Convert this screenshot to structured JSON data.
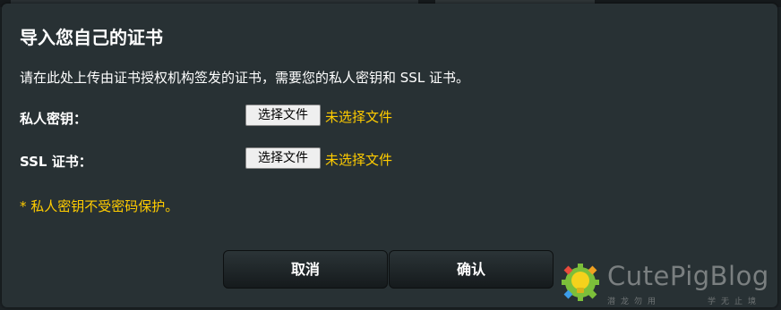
{
  "dialog": {
    "title": "导入您自己的证书",
    "description": "请在此处上传由证书授权机构签发的证书，需要您的私人密钥和 SSL 证书。",
    "fields": [
      {
        "label": "私人密钥：",
        "button_label": "选择文件",
        "status": "未选择文件"
      },
      {
        "label": "SSL 证书：",
        "button_label": "选择文件",
        "status": "未选择文件"
      }
    ],
    "note": "* 私人密钥不受密码保护。",
    "buttons": {
      "cancel_label": "取消",
      "ok_label": "确认"
    }
  },
  "watermark": {
    "text": "CutePigBlog",
    "sub_left": "潜龙勿用",
    "sub_right": "学无止境"
  },
  "colors": {
    "dialog_bg": "#283134",
    "accent_yellow": "#ffcc00",
    "text_white": "#ffffff"
  }
}
